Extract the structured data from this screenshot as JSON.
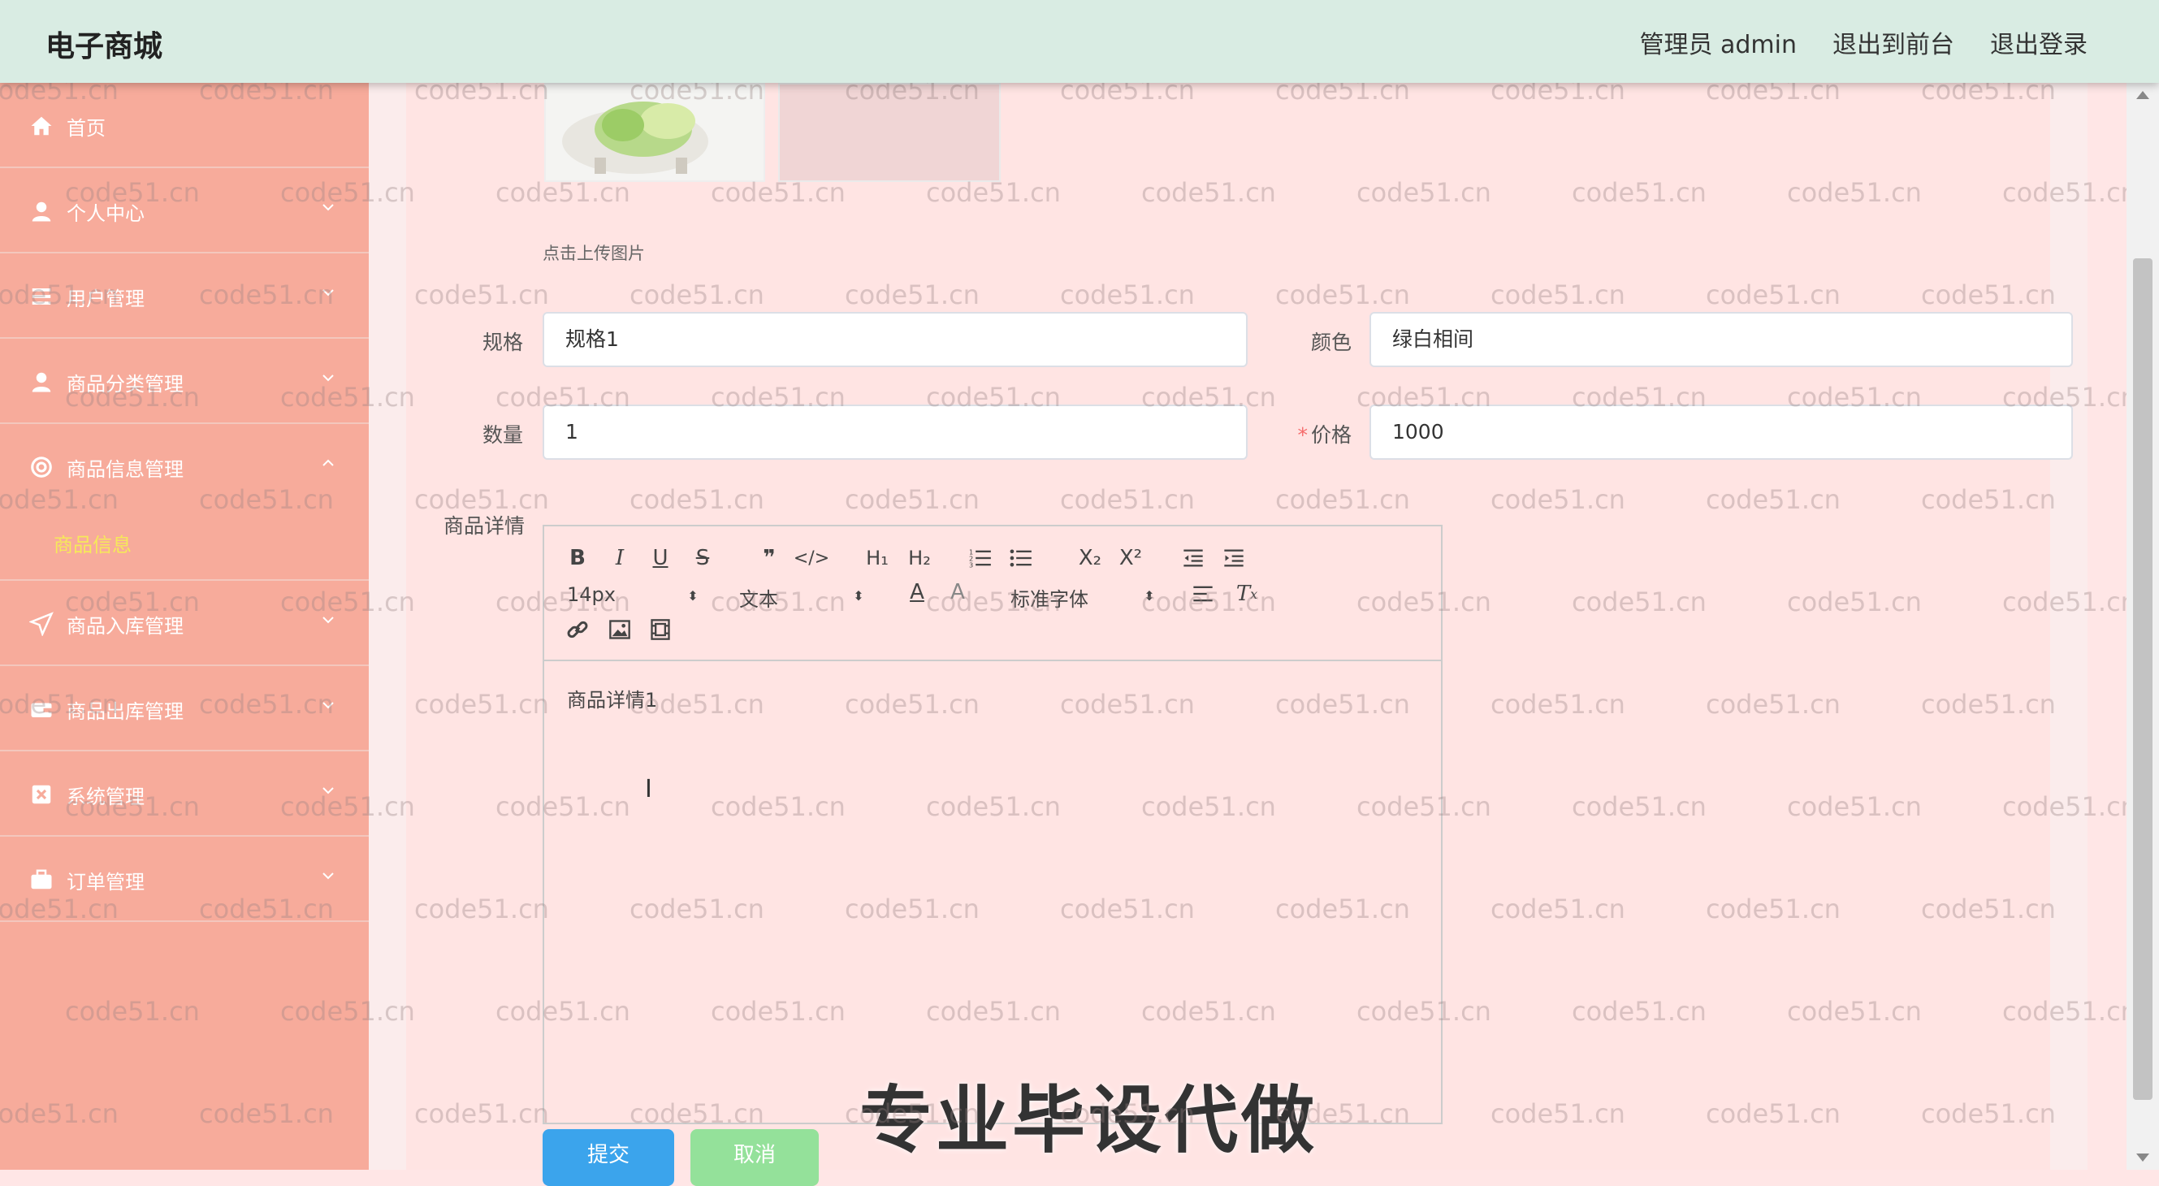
{
  "header": {
    "brand": "电子商城",
    "admin_label": "管理员 admin",
    "front_label": "退出到前台",
    "logout_label": "退出登录"
  },
  "sidebar": {
    "items": [
      {
        "label": "首页",
        "icon": "home-icon"
      },
      {
        "label": "个人中心",
        "icon": "user-icon"
      },
      {
        "label": "用户管理",
        "icon": "list-icon"
      },
      {
        "label": "商品分类管理",
        "icon": "user-icon"
      },
      {
        "label": "商品信息管理",
        "icon": "target-icon",
        "expanded": true
      },
      {
        "label": "商品入库管理",
        "icon": "send-icon"
      },
      {
        "label": "商品出库管理",
        "icon": "wallet-icon"
      },
      {
        "label": "系统管理",
        "icon": "box-icon"
      },
      {
        "label": "订单管理",
        "icon": "briefcase-icon"
      }
    ],
    "active_sub": "商品信息"
  },
  "form": {
    "upload_hint": "点击上传图片",
    "spec_label": "规格",
    "spec_value": "规格1",
    "color_label": "颜色",
    "color_value": "绿白相间",
    "qty_label": "数量",
    "qty_value": "1",
    "price_label": "价格",
    "price_required": "*",
    "price_value": "1000",
    "detail_label": "商品详情"
  },
  "editor": {
    "font_size": "14px",
    "block_type": "文本",
    "font_family": "标准字体",
    "content": "商品详情1"
  },
  "buttons": {
    "submit": "提交",
    "cancel": "取消"
  },
  "overlay": {
    "promo": "专业毕设代做",
    "watermark": "code51.cn"
  },
  "colors": {
    "header_bg": "#d9ece3",
    "sidebar_bg": "#f7ab9b",
    "panel_bg": "#ffe4e3",
    "submenu_active": "#f6e95a",
    "submit_bg": "#3ba4ec",
    "cancel_bg": "#94e19a"
  }
}
